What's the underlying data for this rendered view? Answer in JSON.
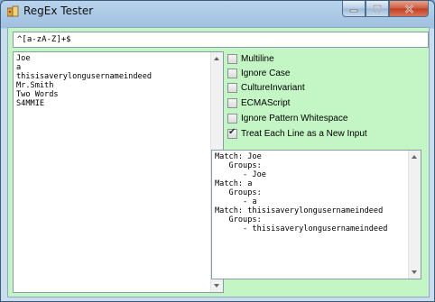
{
  "window": {
    "title": "RegEx Tester"
  },
  "pattern": {
    "value": "^[a-zA-Z]+$"
  },
  "input_lines": [
    "Joe",
    "a",
    "thisisaverylongusernameindeed",
    "Mr.Smith",
    "Two Words",
    "S4MMIE"
  ],
  "options": [
    {
      "label": "Multiline",
      "checked": false
    },
    {
      "label": "Ignore Case",
      "checked": false
    },
    {
      "label": "CultureInvariant",
      "checked": false
    },
    {
      "label": "ECMAScript",
      "checked": false
    },
    {
      "label": "Ignore Pattern Whitespace",
      "checked": false
    },
    {
      "label": "Treat Each Line as a New Input",
      "checked": true
    }
  ],
  "output_lines": [
    "Match: Joe",
    "   Groups:",
    "      - Joe",
    "Match: a",
    "   Groups:",
    "      - a",
    "Match: thisisaverylongusernameindeed",
    "   Groups:",
    "      - thisisaverylongusernameindeed"
  ]
}
